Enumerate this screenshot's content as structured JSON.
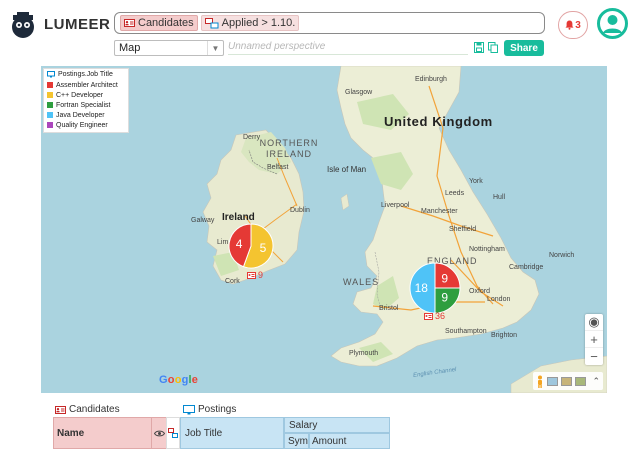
{
  "app": {
    "brand": "LUMEER"
  },
  "search": {
    "collection_chip": "Candidates",
    "attribute_chip": "Applied > 1.10.",
    "attribute_after": ""
  },
  "notifications": {
    "count": "3"
  },
  "perspective": {
    "selected": "Map",
    "name_placeholder": "Unnamed perspective",
    "share_label": "Share"
  },
  "legend": {
    "title": "Postings.Job Title",
    "items": [
      {
        "label": "Assembler Architect",
        "color": "#e53935"
      },
      {
        "label": "C++ Developer",
        "color": "#f4c430"
      },
      {
        "label": "Fortran Specialist",
        "color": "#2e9e3f"
      },
      {
        "label": "Java Developer",
        "color": "#4fc3f7"
      },
      {
        "label": "Quality Engineer",
        "color": "#ab47bc"
      }
    ]
  },
  "map": {
    "places": {
      "united_kingdom": "United Kingdom",
      "northern_ireland": "NORTHERN IRELAND",
      "isle_of_man": "Isle of Man",
      "ireland": "Ireland",
      "wales": "WALES",
      "england": "ENGLAND",
      "glasgow": "Glasgow",
      "belfast": "Belfast",
      "dublin": "Dublin",
      "galway": "Galway",
      "limerick": "Lim",
      "cork": "Cork",
      "liverpool": "Liverpool",
      "manchester": "Manchester",
      "sheffield": "Sheffield",
      "birmingham": "Birmingham",
      "cambridge": "Cambridge",
      "london": "London",
      "bristol": "Bristol",
      "plymouth": "Plymouth",
      "southampton": "Southampton",
      "brighton": "Brighton",
      "english_channel": "English Channel",
      "leeds": "Leeds",
      "york": "York",
      "hull": "Hull",
      "nottingham": "Nottingham",
      "oxford": "Oxford",
      "norwich": "Norwich",
      "derry": "Derry",
      "edinburgh": "Edinburgh"
    },
    "clusters": [
      {
        "id": "ireland",
        "total": 9,
        "slices": [
          {
            "label": "5",
            "value": 5,
            "color": "#f4c430"
          },
          {
            "label": "4",
            "value": 4,
            "color": "#e53935"
          }
        ]
      },
      {
        "id": "england",
        "total": 36,
        "slices": [
          {
            "label": "18",
            "value": 18,
            "color": "#4fc3f7"
          },
          {
            "label": "9",
            "value": 9,
            "color": "#e53935"
          },
          {
            "label": "9",
            "value": 9,
            "color": "#2e9e3f"
          }
        ]
      }
    ],
    "google_label": "Google"
  },
  "table": {
    "candidates_label": "Candidates",
    "postings_label": "Postings",
    "name_header": "Name",
    "job_title_header": "Job Title",
    "salary_header": "Salary",
    "sym_header": "Sym",
    "amount_header": "Amount"
  }
}
